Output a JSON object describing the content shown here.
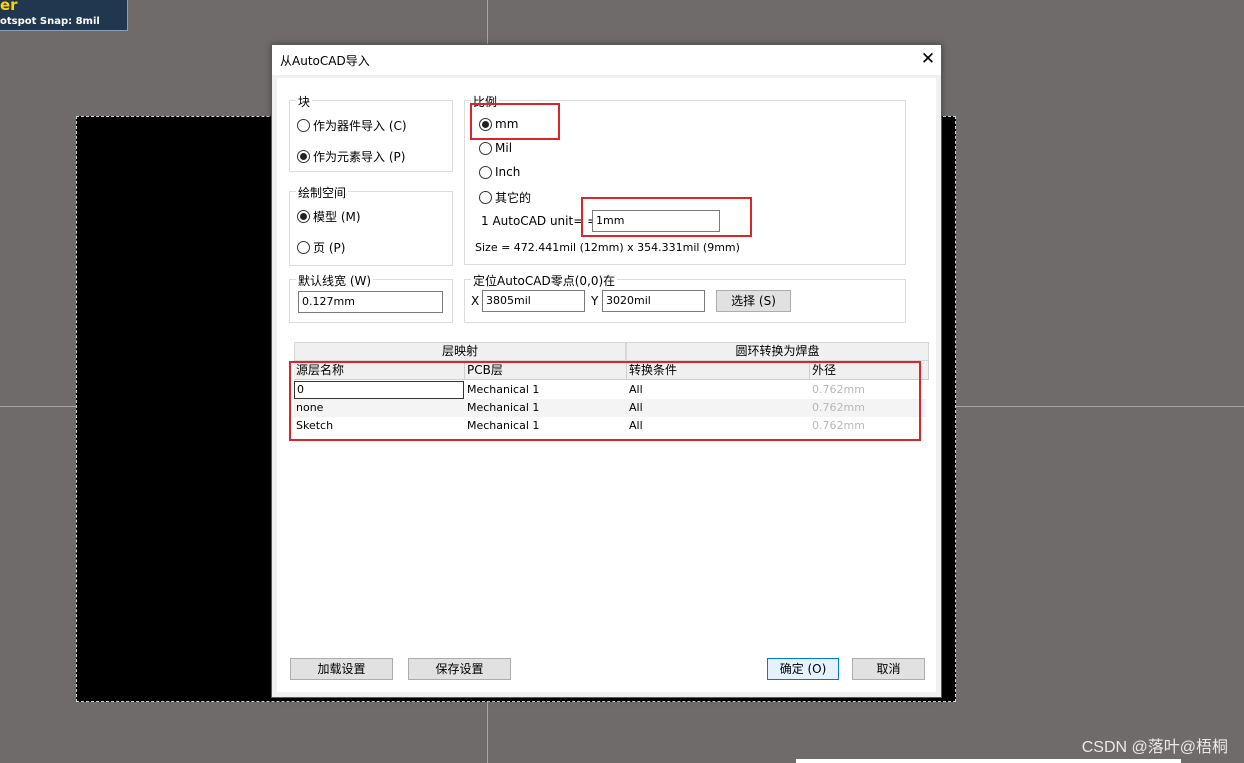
{
  "background": {
    "hud_line1": "er",
    "hud_line2": "otspot Snap: 8mil",
    "watermark": "CSDN @落叶@梧桐"
  },
  "dialog": {
    "title": "从AutoCAD导入",
    "close_glyph": "✕",
    "block_group": {
      "label": "块",
      "options": [
        {
          "label": "作为器件导入 (C)",
          "selected": false
        },
        {
          "label": "作为元素导入 (P)",
          "selected": true
        }
      ]
    },
    "space_group": {
      "label": "绘制空间",
      "options": [
        {
          "label": "模型 (M)",
          "selected": true
        },
        {
          "label": "页 (P)",
          "selected": false
        }
      ]
    },
    "scale_group": {
      "label": "比例",
      "options": [
        {
          "label": "mm",
          "selected": true
        },
        {
          "label": "Mil",
          "selected": false
        },
        {
          "label": "Inch",
          "selected": false
        },
        {
          "label": "其它的",
          "selected": false
        }
      ],
      "unit_label": "1 AutoCAD unit= =",
      "unit_value": "1mm",
      "size_text": "Size = 472.441mil (12mm) x 354.331mil (9mm)"
    },
    "linewidth_group": {
      "label": "默认线宽 (W)",
      "value": "0.127mm"
    },
    "origin_group": {
      "label": "定位AutoCAD零点(0,0)在",
      "x_label": "X",
      "x_value": "3805mil",
      "y_label": "Y",
      "y_value": "3020mil",
      "select_button": "选择 (S)"
    },
    "grid": {
      "group_headers": [
        "层映射",
        "圆环转换为焊盘"
      ],
      "columns": [
        "源层名称",
        "PCB层",
        "转换条件",
        "外径"
      ],
      "rows": [
        [
          "0",
          "Mechanical 1",
          "All",
          "0.762mm"
        ],
        [
          "none",
          "Mechanical 1",
          "All",
          "0.762mm"
        ],
        [
          "Sketch",
          "Mechanical 1",
          "All",
          "0.762mm"
        ]
      ]
    },
    "buttons": {
      "load": "加载设置",
      "save": "保存设置",
      "ok": "确定 (O)",
      "cancel": "取消"
    }
  },
  "colors": {
    "background": "#6f6b6a",
    "highlight_red": "#d9262c",
    "primary_border": "#0078d7"
  }
}
